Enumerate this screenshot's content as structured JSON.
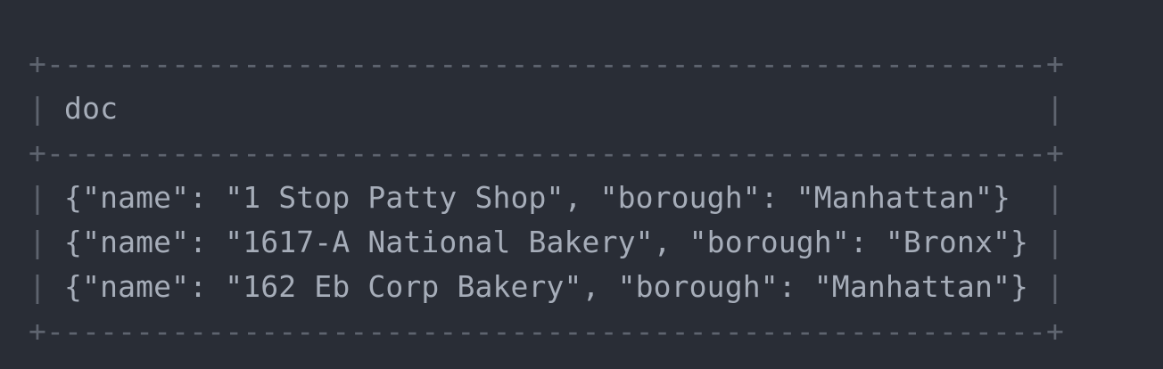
{
  "table": {
    "border_top": "+--------------------------------------------------------+",
    "border_mid": "+--------------------------------------------------------+",
    "border_bottom": "+--------------------------------------------------------+",
    "pipe": "|",
    "header": " doc                                                    ",
    "rows": [
      " {\"name\": \"1 Stop Patty Shop\", \"borough\": \"Manhattan\"}  ",
      " {\"name\": \"1617-A National Bakery\", \"borough\": \"Bronx\"} ",
      " {\"name\": \"162 Eb Corp Bakery\", \"borough\": \"Manhattan\"} "
    ]
  },
  "colors": {
    "background": "#292d36",
    "text": "#a6adb9",
    "border": "#5e646f"
  }
}
